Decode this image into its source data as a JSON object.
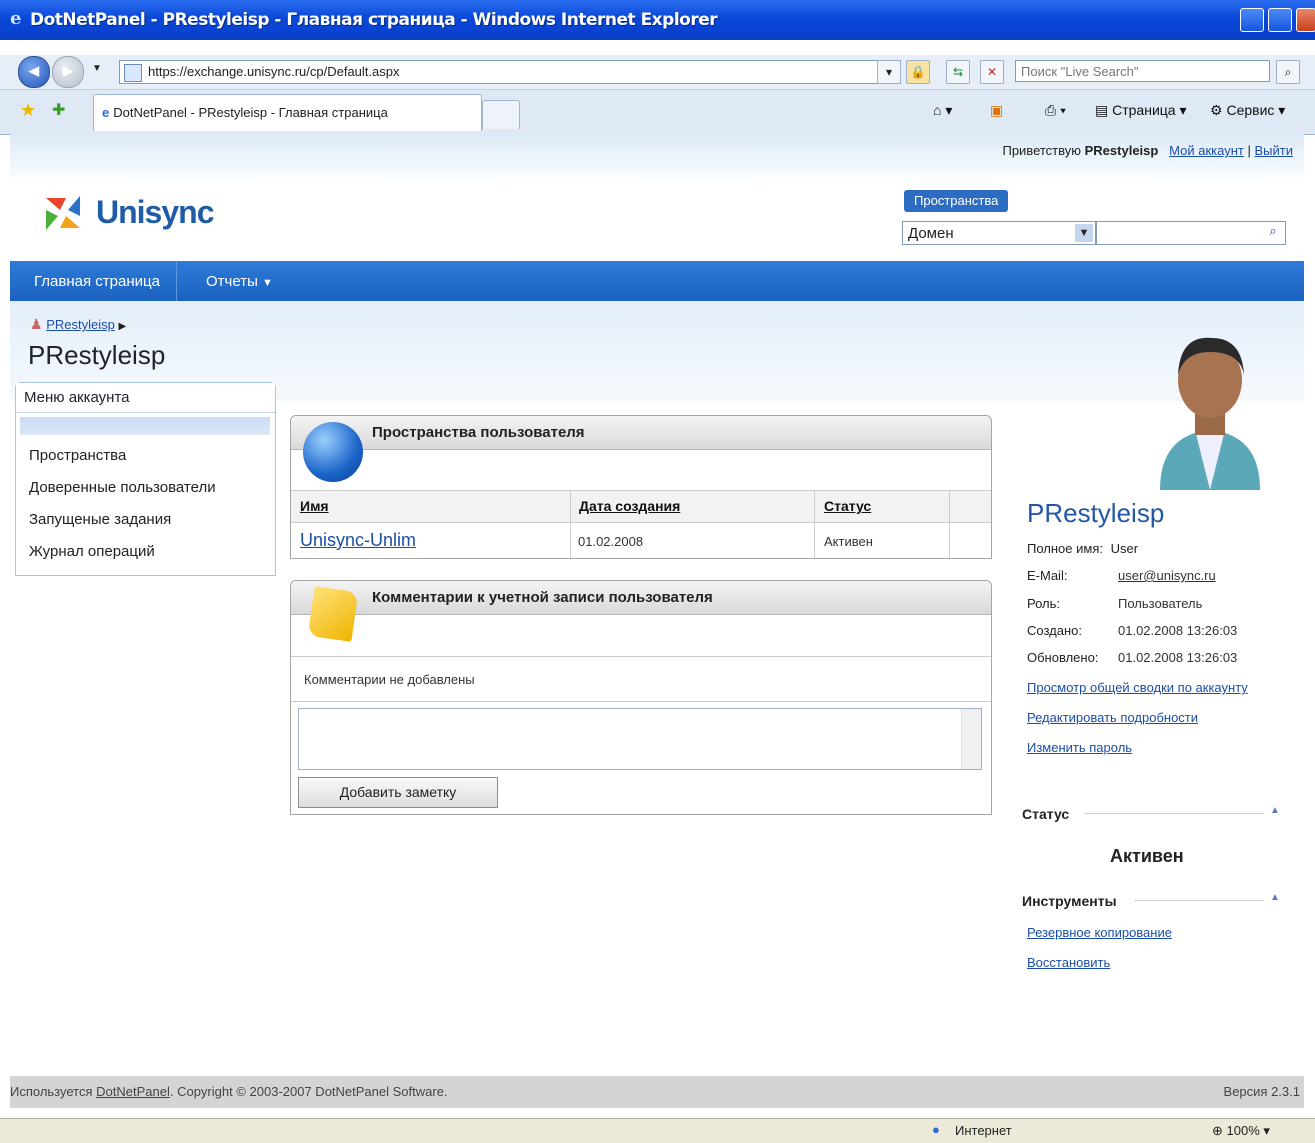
{
  "window": {
    "title": "DotNetPanel - PRestyleisp - Главная страница - Windows Internet Explorer",
    "url": "https://exchange.unisync.ru/cp/Default.aspx",
    "search_placeholder": "Поиск \"Live Search\"",
    "tab_title": "DotNetPanel - PRestyleisp - Главная страница",
    "toolbar_page": "Страница",
    "toolbar_service": "Сервис",
    "status_zone": "Интернет",
    "zoom": "100%"
  },
  "header": {
    "greeting_prefix": "Приветствую",
    "username": "PRestyleisp",
    "my_account": "Мой аккаунт",
    "separator": "|",
    "logout": "Выйти",
    "brand": "Unisync",
    "spaces_label": "Пространства",
    "domain_select": "Домен"
  },
  "menu": {
    "home": "Главная страница",
    "reports": "Отчеты"
  },
  "breadcrumb": {
    "user": "PRestyleisp"
  },
  "page_title": "PRestyleisp",
  "left_menu": {
    "title": "Меню аккаунта",
    "items": [
      "Пространства",
      "Доверенные пользователи",
      "Запущеные задания",
      "Журнал операций"
    ]
  },
  "spaces_panel": {
    "title": "Пространства пользователя",
    "columns": [
      "Имя",
      "Дата создания",
      "Статус"
    ],
    "rows": [
      {
        "name": "Unisync-Unlim",
        "created": "01.02.2008",
        "status": "Активен"
      }
    ]
  },
  "comments_panel": {
    "title": "Комментарии к учетной записи пользователя",
    "empty_text": "Комментарии не добавлены",
    "add_button": "Добавить заметку"
  },
  "profile": {
    "name": "PRestyleisp",
    "full_name_label": "Полное имя:",
    "full_name": "User",
    "email_label": "E-Mail:",
    "email": "user@unisync.ru",
    "role_label": "Роль:",
    "role": "Пользователь",
    "created_label": "Создано:",
    "created": "01.02.2008 13:26:03",
    "updated_label": "Обновлено:",
    "updated": "01.02.2008 13:26:03",
    "link_summary": "Просмотр общей сводки по аккаунту",
    "link_edit": "Редактировать подробности",
    "link_password": "Изменить пароль",
    "status_title": "Статус",
    "status_value": "Активен",
    "tools_title": "Инструменты",
    "tool_backup": "Резервное копирование",
    "tool_restore": "Восстановить"
  },
  "footer": {
    "prefix": "Используется",
    "product": "DotNetPanel",
    "copyright": ". Copyright © 2003-2007 DotNetPanel Software.",
    "version": "Версия 2.3.1"
  },
  "colors": {
    "accent": "#1f5ca8",
    "menubar": "#2a72d0",
    "link": "#1a4ea8"
  }
}
